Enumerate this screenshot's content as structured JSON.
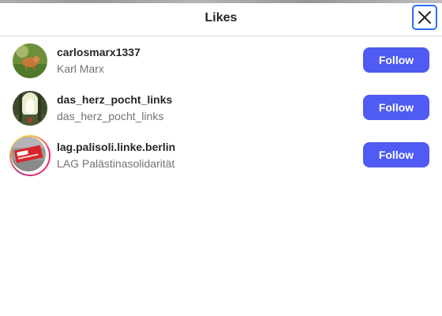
{
  "header": {
    "title": "Likes",
    "close_icon": "close-icon"
  },
  "likes": [
    {
      "username": "carlosmarx1337",
      "full_name": "Karl Marx",
      "button_label": "Follow",
      "has_story_ring": false
    },
    {
      "username": "das_herz_pocht_links",
      "full_name": "das_herz_pocht_links",
      "button_label": "Follow",
      "has_story_ring": false
    },
    {
      "username": "lag.palisoli.linke.berlin",
      "full_name": "LAG Palästinasolidarität",
      "button_label": "Follow",
      "has_story_ring": true
    }
  ],
  "colors": {
    "follow_button": "#4f5bf2",
    "close_focus_outline": "#2a6df4",
    "divider": "#dbdbdb"
  }
}
